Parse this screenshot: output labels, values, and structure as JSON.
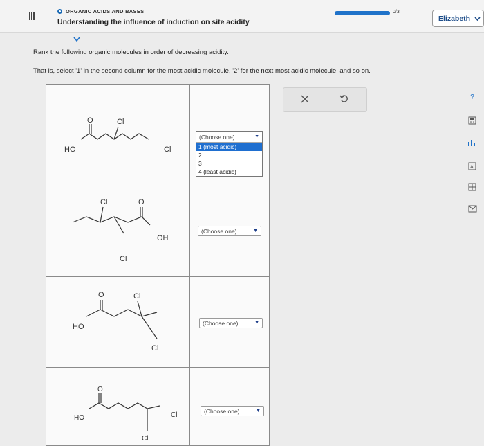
{
  "header": {
    "topic": "ORGANIC ACIDS AND BASES",
    "title": "Understanding the influence of induction on site acidity",
    "progress_label": "0/3",
    "user_name": "Elizabeth"
  },
  "question": {
    "instruction_1": "Rank the following organic molecules in order of decreasing acidity.",
    "instruction_2": "That is, select '1' in the second column for the most acidic molecule, '2' for the next most acidic molecule, and so on."
  },
  "molecules": [
    {
      "labels": {
        "o": "O",
        "cl1": "Cl",
        "ho": "HO",
        "cl2": "Cl"
      }
    },
    {
      "labels": {
        "cl1": "Cl",
        "o": "O",
        "oh": "OH",
        "cl2": "Cl"
      }
    },
    {
      "labels": {
        "o": "O",
        "cl1": "Cl",
        "ho": "HO",
        "cl2": "Cl"
      }
    },
    {
      "labels": {
        "o": "O",
        "ho": "HO",
        "cl1": "Cl",
        "cl2": "Cl"
      }
    }
  ],
  "select": {
    "placeholder": "(Choose one)",
    "options": [
      "1 (most acidic)",
      "2",
      "3",
      "4 (least acidic)"
    ],
    "highlighted": "1 (most acidic)"
  },
  "icons": {
    "menu": "hamburger-icon",
    "close": "x-icon",
    "undo": "undo-icon",
    "help": "question-icon",
    "calculator": "calculator-icon",
    "data": "data-icon",
    "periodic": "periodic-table-icon",
    "reference": "reference-icon",
    "mail": "mail-icon"
  },
  "colors": {
    "accent": "#1f72c9",
    "highlight": "#1f6fd0"
  }
}
